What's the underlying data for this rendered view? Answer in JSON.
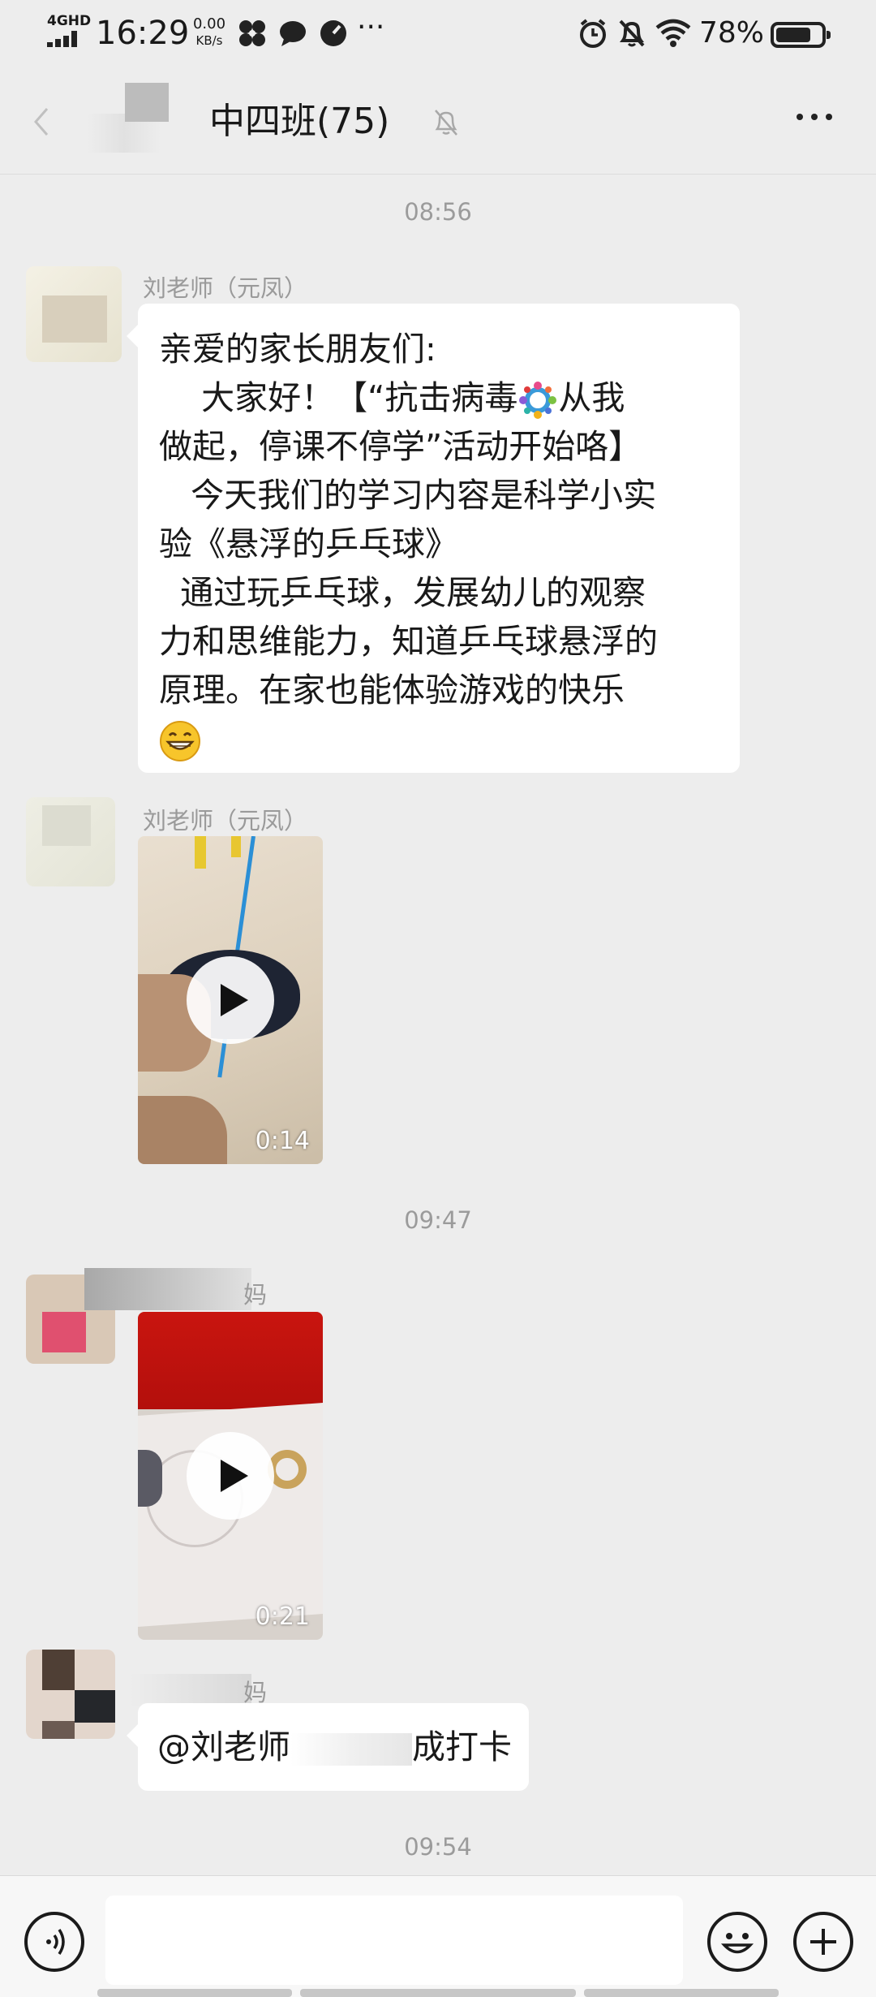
{
  "status_bar": {
    "network": "4GHD",
    "time": "16:29",
    "speed_value": "0.00",
    "speed_unit": "KB/s",
    "battery_percent": "78%",
    "battery_level": 0.78
  },
  "nav": {
    "title": "中四班(75)"
  },
  "messages": {
    "ts1": "08:56",
    "sender1": "刘老师（元凤）",
    "text1_lines": [
      "亲爱的家长朋友们:",
      "    大家好！【“抗击病毒",
      "从我",
      "做起，停课不停学”活动开始咯】",
      "   今天我们的学习内容是科学小实",
      "验《悬浮的乒乓球》",
      "  通过玩乒乓球，发展幼儿的观察",
      "力和思维能力，知道乒乓球悬浮的",
      "原理。在家也能体验游戏的快乐"
    ],
    "sender2": "刘老师（元凤）",
    "video1_duration": "0:14",
    "ts2": "09:47",
    "sender3": "妈",
    "video2_duration": "0:21",
    "sender4": "妈",
    "text4_mention": "@刘老师",
    "text4_tail": "成打卡",
    "ts3": "09:54"
  },
  "icons": {
    "back": "chevron-left-icon",
    "mute": "bell-off-icon",
    "more": "more-dots-icon",
    "voice": "voice-icon",
    "emoji": "emoji-icon",
    "plus": "plus-icon"
  }
}
